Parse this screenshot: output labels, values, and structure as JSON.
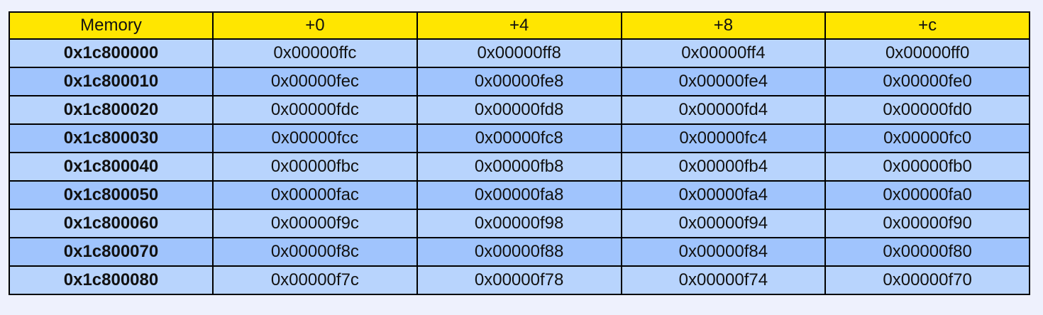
{
  "colors": {
    "page_background": "#eef1fd",
    "header_background": "#ffe600",
    "row_light": "#b8d4fd",
    "row_dark": "#a0c4fd",
    "border": "#000000"
  },
  "table": {
    "headers": [
      "Memory",
      "+0",
      "+4",
      "+8",
      "+c"
    ],
    "rows": [
      {
        "address": "0x1c800000",
        "cells": [
          "0x00000ffc",
          "0x00000ff8",
          "0x00000ff4",
          "0x00000ff0"
        ]
      },
      {
        "address": "0x1c800010",
        "cells": [
          "0x00000fec",
          "0x00000fe8",
          "0x00000fe4",
          "0x00000fe0"
        ]
      },
      {
        "address": "0x1c800020",
        "cells": [
          "0x00000fdc",
          "0x00000fd8",
          "0x00000fd4",
          "0x00000fd0"
        ]
      },
      {
        "address": "0x1c800030",
        "cells": [
          "0x00000fcc",
          "0x00000fc8",
          "0x00000fc4",
          "0x00000fc0"
        ]
      },
      {
        "address": "0x1c800040",
        "cells": [
          "0x00000fbc",
          "0x00000fb8",
          "0x00000fb4",
          "0x00000fb0"
        ]
      },
      {
        "address": "0x1c800050",
        "cells": [
          "0x00000fac",
          "0x00000fa8",
          "0x00000fa4",
          "0x00000fa0"
        ]
      },
      {
        "address": "0x1c800060",
        "cells": [
          "0x00000f9c",
          "0x00000f98",
          "0x00000f94",
          "0x00000f90"
        ]
      },
      {
        "address": "0x1c800070",
        "cells": [
          "0x00000f8c",
          "0x00000f88",
          "0x00000f84",
          "0x00000f80"
        ]
      },
      {
        "address": "0x1c800080",
        "cells": [
          "0x00000f7c",
          "0x00000f78",
          "0x00000f74",
          "0x00000f70"
        ]
      }
    ]
  }
}
